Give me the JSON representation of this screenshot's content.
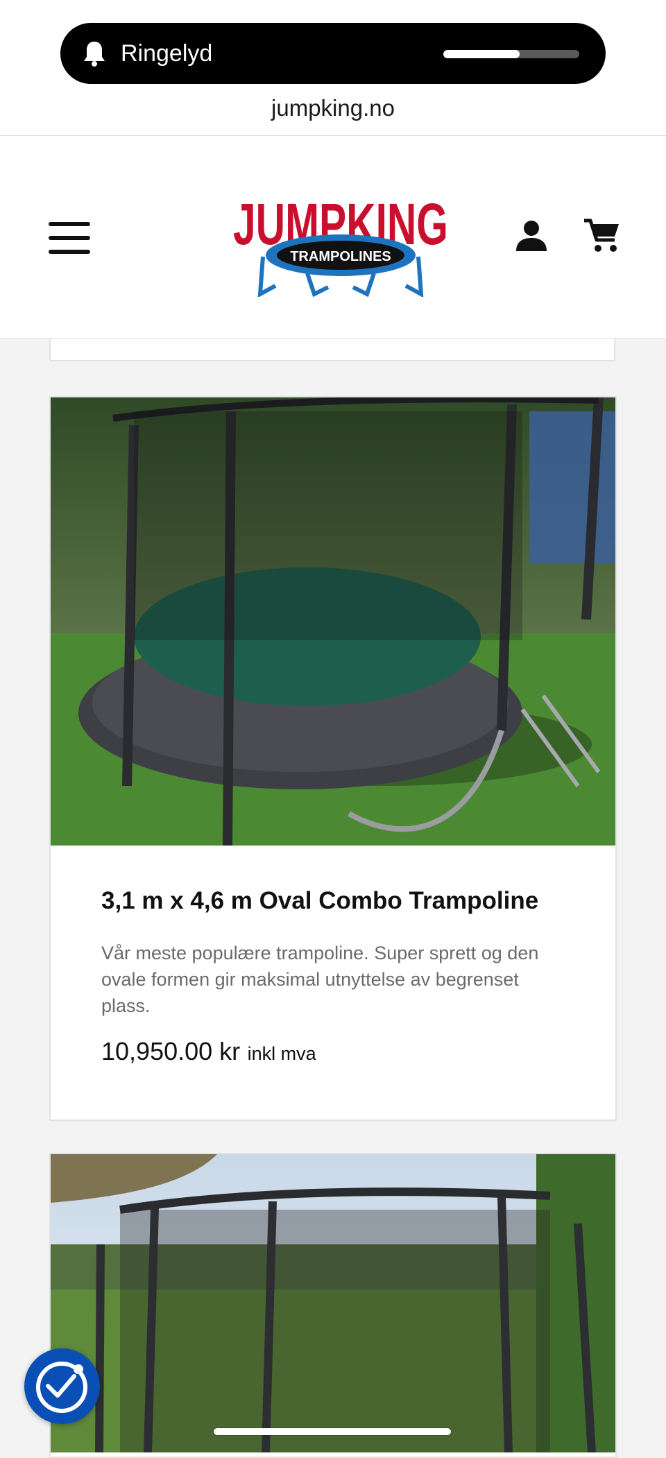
{
  "status": {
    "ringer_label": "Ringelyd",
    "ringer_icon": "bell-icon",
    "volume_level": 0.56
  },
  "browser": {
    "url": "jumpking.no"
  },
  "header": {
    "menu_icon": "hamburger-menu-icon",
    "logo": {
      "wordmark": "JUMPKING",
      "subtitle": "TRAMPOLINES"
    },
    "account_icon": "user-icon",
    "cart_icon": "cart-icon"
  },
  "products": [
    {
      "title": "3,1 m x 4,6 m Oval Combo Trampoline",
      "description": "Vår meste populære trampoline. Super sprett og den ovale formen gir maksimal utnyttelse av begrenset plass.",
      "price": "10,950.00 kr",
      "vat_note": "inkl mva"
    }
  ],
  "accessibility": {
    "icon": "accessibility-check-icon"
  },
  "colors": {
    "logo_red": "#c8102e",
    "logo_blue": "#1e73be",
    "a11y_blue": "#0a4fb6"
  }
}
